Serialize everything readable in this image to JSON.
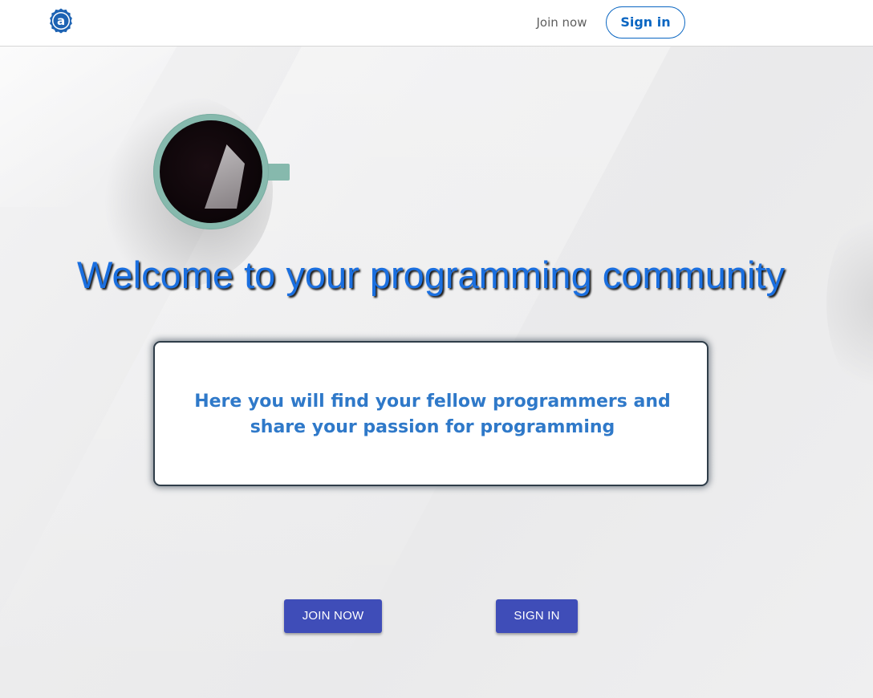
{
  "header": {
    "logo_glyph": "a",
    "nav": {
      "join_label": "Join now",
      "signin_label": "Sign in"
    }
  },
  "hero": {
    "title": "Welcome to your programming community",
    "card_text": "Here you will find your fellow programmers and share your passion for programming",
    "buttons": {
      "join_label": "JOIN NOW",
      "signin_label": "SIGN IN"
    }
  },
  "colors": {
    "brand_blue": "#0a66c2",
    "title_blue": "#1a6fe0",
    "card_text_blue": "#2f79c9",
    "button_indigo": "#3f4db8",
    "cup_teal": "#86b9ad"
  },
  "icons": {
    "logo": "at-sign-badge-icon",
    "cup": "coffee-cup-icon"
  }
}
